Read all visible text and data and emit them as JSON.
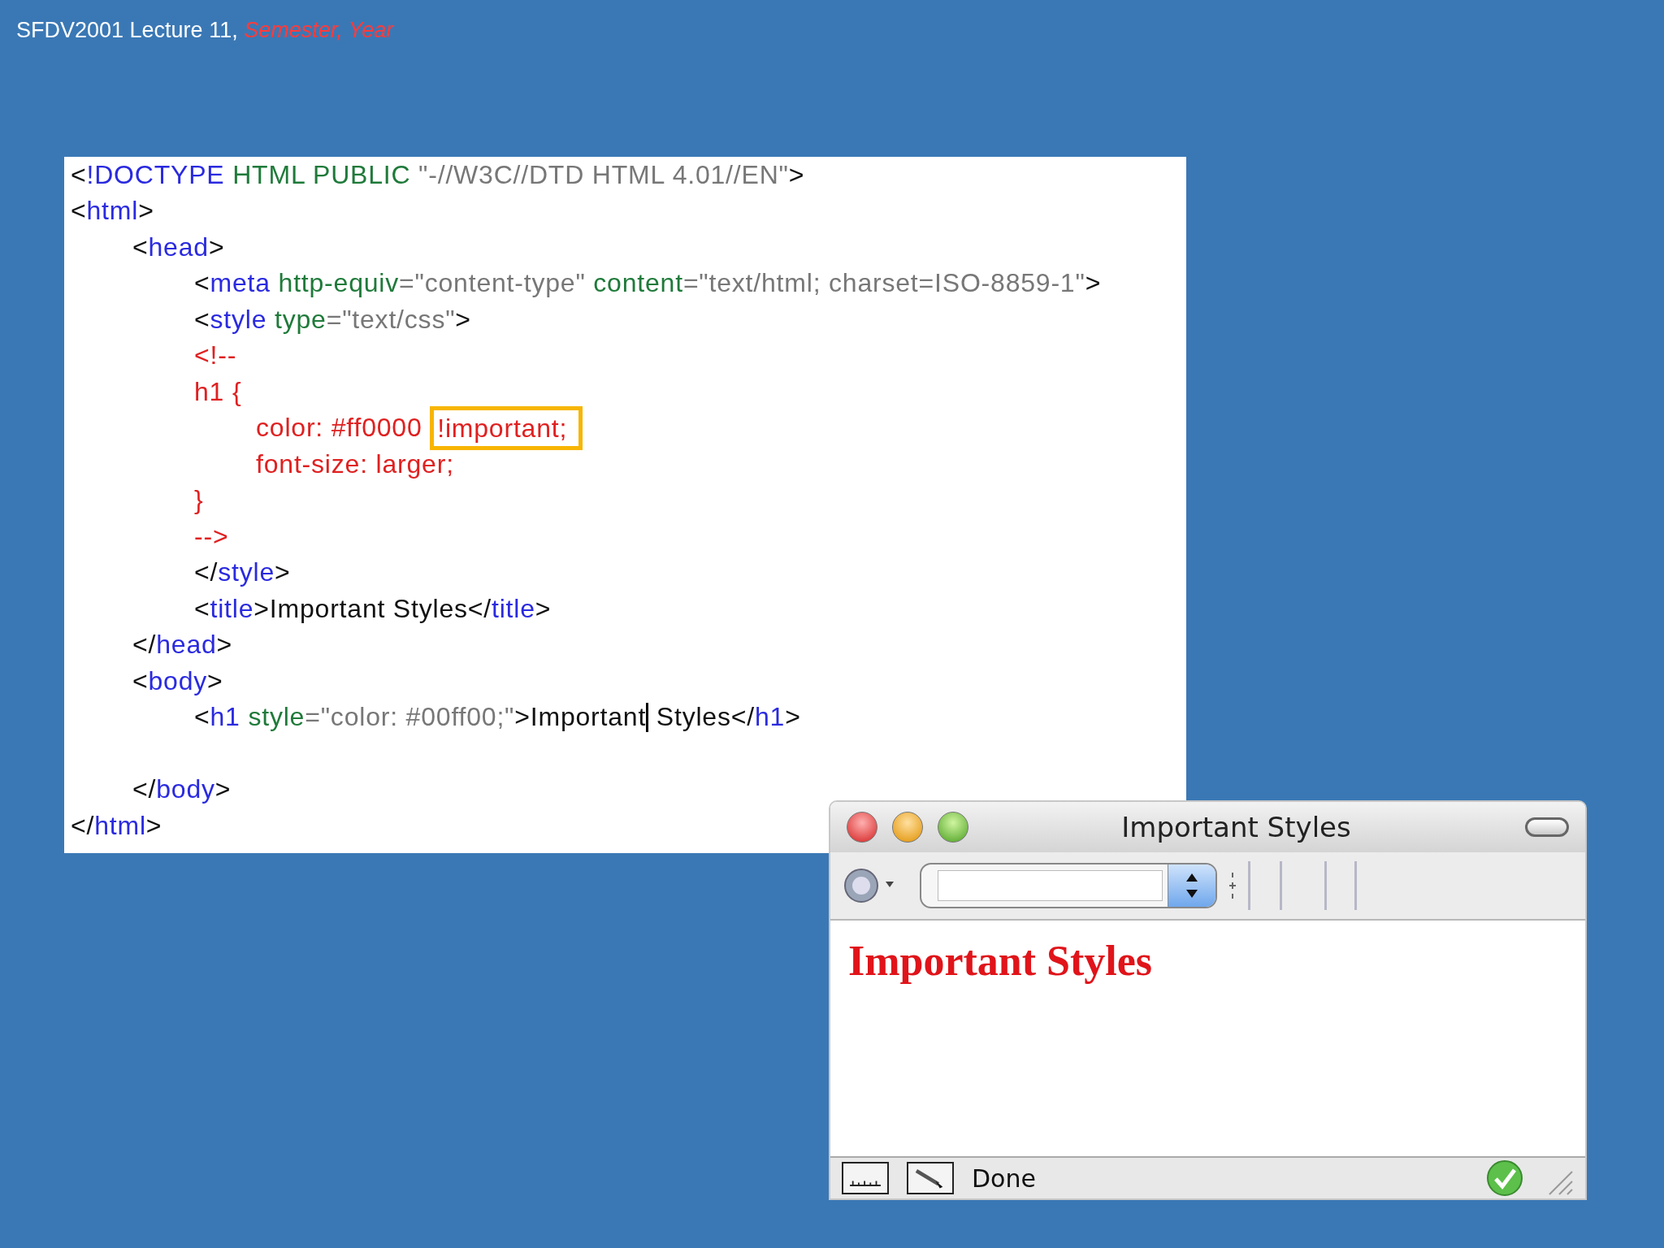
{
  "header": {
    "text": "SFDV2001 Lecture 11, *Semester, Year*"
  },
  "code": {
    "lines": [
      {
        "tokens": [
          {
            "kind": "punct",
            "text": "<"
          },
          {
            "kind": "tag",
            "text": "!DOCTYPE"
          },
          {
            "kind": "attr",
            "text": " HTML PUBLIC "
          },
          {
            "kind": "value",
            "text": "\"-//W3C//DTD HTML 4.01//EN\""
          },
          {
            "kind": "punct",
            "text": ">"
          }
        ]
      },
      {
        "tokens": [
          {
            "kind": "punct",
            "text": "<"
          },
          {
            "kind": "tag",
            "text": "html"
          },
          {
            "kind": "punct",
            "text": ">"
          }
        ],
        "children": [
          {
            "tokens": [
              {
                "kind": "punct",
                "text": "<"
              },
              {
                "kind": "tag",
                "text": "head"
              },
              {
                "kind": "punct",
                "text": ">"
              }
            ],
            "children": [
              {
                "tokens": [
                  {
                    "kind": "punct",
                    "text": "<"
                  },
                  {
                    "kind": "tag",
                    "text": "meta"
                  },
                  {
                    "kind": "attr",
                    "text": " http-equiv"
                  },
                  {
                    "kind": "value",
                    "text": "=\"content-type\" "
                  },
                  {
                    "kind": "attr",
                    "text": "content"
                  },
                  {
                    "kind": "value",
                    "text": "=\"text/html; charset=ISO-8859-1\""
                  },
                  {
                    "kind": "punct",
                    "text": ">"
                  }
                ]
              },
              {
                "tokens": [
                  {
                    "kind": "punct",
                    "text": "<"
                  },
                  {
                    "kind": "tag",
                    "text": "style"
                  },
                  {
                    "kind": "attr",
                    "text": " type"
                  },
                  {
                    "kind": "value",
                    "text": "=\"text/css\""
                  },
                  {
                    "kind": "punct",
                    "text": ">"
                  }
                ]
              },
              {
                "tokens": [
                  {
                    "kind": "css",
                    "text": "<!--"
                  }
                ]
              },
              {
                "tokens": [
                  {
                    "kind": "css",
                    "text": "h1 {"
                  }
                ],
                "children": [
                  {
                    "tokens": [
                      {
                        "kind": "css",
                        "text": "color: #ff0000 "
                      },
                      {
                        "kind": "css",
                        "text": "!important;",
                        "highlighted": true
                      }
                    ]
                  },
                  {
                    "tokens": [
                      {
                        "kind": "css",
                        "text": "font-size: larger;"
                      }
                    ]
                  }
                ]
              },
              {
                "tokens": [
                  {
                    "kind": "css",
                    "text": "}"
                  }
                ]
              },
              {
                "tokens": [
                  {
                    "kind": "css",
                    "text": "-->"
                  }
                ]
              },
              {
                "tokens": [
                  {
                    "kind": "punct",
                    "text": "</"
                  },
                  {
                    "kind": "tag",
                    "text": "style"
                  },
                  {
                    "kind": "punct",
                    "text": ">"
                  }
                ]
              },
              {
                "tokens": [
                  {
                    "kind": "punct",
                    "text": "<"
                  },
                  {
                    "kind": "tag",
                    "text": "title"
                  },
                  {
                    "kind": "punct",
                    "text": ">"
                  },
                  {
                    "kind": "text",
                    "text": "Important Styles"
                  },
                  {
                    "kind": "punct",
                    "text": "</"
                  },
                  {
                    "kind": "tag",
                    "text": "title"
                  },
                  {
                    "kind": "punct",
                    "text": ">"
                  }
                ]
              }
            ]
          },
          {
            "tokens": [
              {
                "kind": "punct",
                "text": "</"
              },
              {
                "kind": "tag",
                "text": "head"
              },
              {
                "kind": "punct",
                "text": ">"
              }
            ]
          },
          {
            "tokens": [
              {
                "kind": "punct",
                "text": "<"
              },
              {
                "kind": "tag",
                "text": "body"
              },
              {
                "kind": "punct",
                "text": ">"
              }
            ],
            "children": [
              {
                "tokens": [
                  {
                    "kind": "punct",
                    "text": "<"
                  },
                  {
                    "kind": "tag",
                    "text": "h1"
                  },
                  {
                    "kind": "attr",
                    "text": " style"
                  },
                  {
                    "kind": "value",
                    "text": "=\"color: #00ff00;\""
                  },
                  {
                    "kind": "punct",
                    "text": ">"
                  },
                  {
                    "kind": "text",
                    "text": "Important"
                  },
                  {
                    "kind": "caret"
                  },
                  {
                    "kind": "text",
                    "text": " Styles"
                  },
                  {
                    "kind": "punct",
                    "text": "</"
                  },
                  {
                    "kind": "tag",
                    "text": "h1"
                  },
                  {
                    "kind": "punct",
                    "text": ">"
                  }
                ],
                "blank_after": true
              }
            ]
          },
          {
            "tokens": [
              {
                "kind": "punct",
                "text": "</"
              },
              {
                "kind": "tag",
                "text": "body"
              },
              {
                "kind": "punct",
                "text": ">"
              }
            ]
          }
        ]
      },
      {
        "tokens": [
          {
            "kind": "punct",
            "text": "</"
          },
          {
            "kind": "tag",
            "text": "html"
          },
          {
            "kind": "punct",
            "text": ">"
          }
        ]
      }
    ]
  },
  "browser": {
    "title": "Important Styles",
    "heading": "Important Styles",
    "status": "Done"
  }
}
